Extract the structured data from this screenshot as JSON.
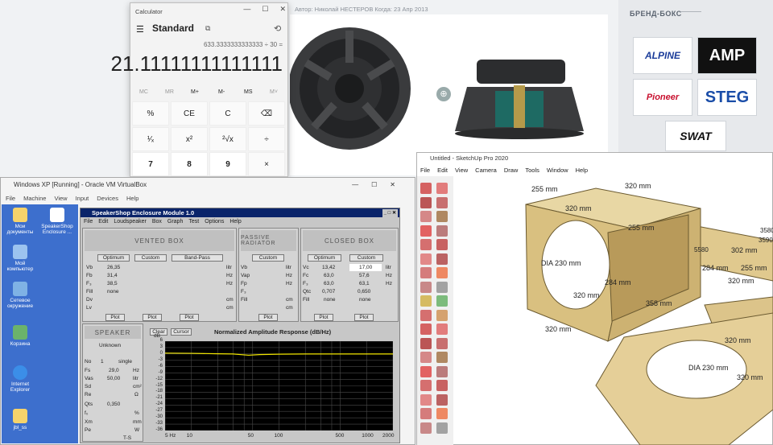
{
  "web": {
    "author_line": "Автор: Николай НЕСТЕРОВ    Когда: 23 Апр 2013",
    "brand_title": "БРЕНД-БОКС",
    "brands": [
      "ALPINE",
      "AMP",
      "Pioneer",
      "STEG",
      "SWAT"
    ]
  },
  "calculator": {
    "title": "Calculator",
    "mode": "Standard",
    "expression": "633.3333333333333 ÷ 30 =",
    "display": "21.11111111111111",
    "memory": [
      "MC",
      "MR",
      "M+",
      "M-",
      "MS",
      "M˅"
    ],
    "keys": [
      "%",
      "CE",
      "C",
      "⌫",
      "¹⁄ₓ",
      "x²",
      "²√x",
      "÷",
      "7",
      "8",
      "9",
      "×"
    ]
  },
  "vbox": {
    "title": "Windows XP [Running] - Oracle VM VirtualBox",
    "menu": [
      "File",
      "Machine",
      "View",
      "Input",
      "Devices",
      "Help"
    ],
    "icons": [
      "Мои документы",
      "SpeakerShop Enclosure ...",
      "Мой компьютер",
      "Сетевое окружение",
      "Корзина",
      "Internet Explorer",
      "jbl_ss"
    ]
  },
  "speakershop": {
    "title": "SpeakerShop Enclosure Module 1.0",
    "menu": [
      "File",
      "Edit",
      "Loudspeaker",
      "Box",
      "Graph",
      "Test",
      "Options",
      "Help"
    ],
    "vented": {
      "head": "VENTED BOX",
      "buttons": [
        "Optimum",
        "Custom",
        "Band-Pass"
      ],
      "rows": [
        {
          "l": "Vb",
          "v": "26,35",
          "u": "litr"
        },
        {
          "l": "Fb",
          "v": "31,4",
          "u": "Hz"
        },
        {
          "l": "F₃",
          "v": "38,5",
          "u": "Hz"
        },
        {
          "l": "Fill",
          "v": "none",
          "u": ""
        },
        {
          "l": "Dv",
          "v": "",
          "u": "cm"
        },
        {
          "l": "Lv",
          "v": "",
          "u": "cm"
        }
      ]
    },
    "passive": {
      "head": "PASSIVE RADIATOR",
      "button": "Custom",
      "units": [
        "litr",
        "Hz",
        "Hz",
        "",
        "cm",
        "cm"
      ],
      "rows": [
        "Vb",
        "Vap",
        "Fp",
        "F₃",
        "Fill"
      ]
    },
    "closed": {
      "head": "CLOSED BOX",
      "buttons": [
        "Optimum",
        "Custom"
      ],
      "rows": [
        {
          "l": "Vc",
          "a": "13,42",
          "b": "17,00",
          "u": "litr"
        },
        {
          "l": "Fc",
          "a": "63,0",
          "b": "57,6",
          "u": "Hz"
        },
        {
          "l": "F₃",
          "a": "63,0",
          "b": "63,1",
          "u": "Hz"
        },
        {
          "l": "Qtc",
          "a": "0,707",
          "b": "0,650",
          "u": ""
        },
        {
          "l": "Fill",
          "a": "none",
          "b": "none",
          "u": ""
        }
      ]
    },
    "plot_label": "Plot",
    "speaker": {
      "head": "SPEAKER",
      "name": "Unknown",
      "count": "1",
      "wiring": "single",
      "rows": [
        {
          "l": "No",
          "v": "1",
          "u": "single"
        },
        {
          "l": "Fs",
          "v": "29,0",
          "u": "Hz"
        },
        {
          "l": "Vas",
          "v": "50,00",
          "u": "litr"
        },
        {
          "l": "Sd",
          "v": "",
          "u": "cm²"
        },
        {
          "l": "Re",
          "v": "",
          "u": "Ω"
        },
        {
          "l": "Qts",
          "v": "0,350",
          "u": ""
        },
        {
          "l": "f₀",
          "v": "",
          "u": "%"
        },
        {
          "l": "Xm",
          "v": "",
          "u": "mm"
        },
        {
          "l": "Pe",
          "v": "",
          "u": "W"
        }
      ],
      "ts": "T-S"
    },
    "graph": {
      "title": "Normalized Amplitude Response (dB/Hz)",
      "clear": "Clear",
      "cursor": "Cursor",
      "db": "dB",
      "yticks": [
        "6",
        "3",
        "0",
        "-3",
        "-6",
        "-9",
        "-12",
        "-15",
        "-18",
        "-21",
        "-24",
        "-27",
        "-30",
        "-33",
        "-36"
      ],
      "xticks": [
        "5 Hz",
        "10",
        "50",
        "100",
        "500",
        "1000",
        "2000"
      ]
    }
  },
  "sketchup": {
    "title": "Untitled - SketchUp Pro 2020",
    "menu": [
      "File",
      "Edit",
      "View",
      "Camera",
      "Draw",
      "Tools",
      "Window",
      "Help"
    ],
    "dims": [
      "255 mm",
      "320 mm",
      "320 mm",
      "255 mm",
      "DIA 230 mm",
      "284 mm",
      "320 mm",
      "358 mm",
      "320 mm",
      "320 mm",
      "DIA 230 mm",
      "320 mm",
      "302 mm",
      "255 mm",
      "284 mm",
      "3580",
      "5580",
      "3590",
      "320 mm"
    ]
  }
}
